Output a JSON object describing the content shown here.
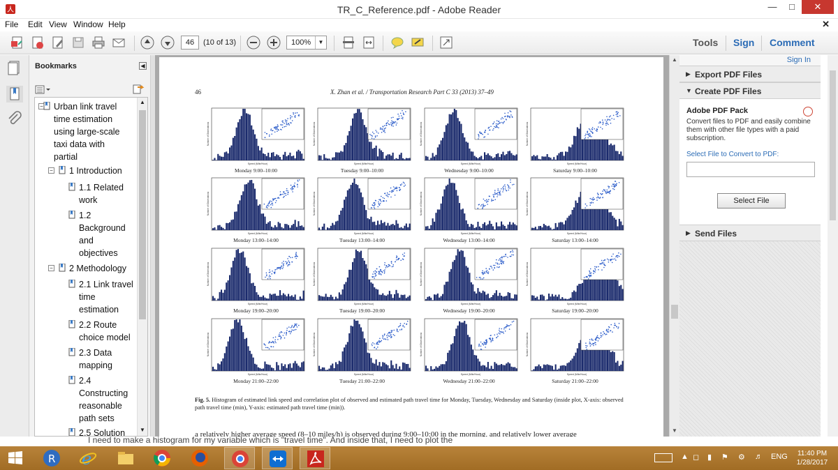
{
  "window": {
    "title": "TR_C_Reference.pdf - Adobe Reader"
  },
  "menu": [
    "File",
    "Edit",
    "View",
    "Window",
    "Help"
  ],
  "toolbar": {
    "page_current": "46",
    "page_count": "(10 of 13)",
    "zoom": "100%",
    "right_tabs": [
      "Tools",
      "Sign",
      "Comment"
    ]
  },
  "bookmarks": {
    "header": "Bookmarks",
    "items": [
      {
        "label": "Urban link travel time estimation using large-scale taxi data with partial",
        "lines": [
          "Urban link travel",
          "time estimation",
          "using large-scale",
          "taxi data with",
          "partial"
        ],
        "toggle": "−"
      },
      {
        "lines": [
          "1 Introduction"
        ],
        "toggle": "−"
      },
      {
        "lines": [
          "1.1 Related",
          "work"
        ]
      },
      {
        "lines": [
          "1.2",
          "Background",
          "and",
          "objectives"
        ]
      },
      {
        "lines": [
          "2 Methodology"
        ],
        "toggle": "−"
      },
      {
        "lines": [
          "2.1 Link travel",
          "time",
          "estimation"
        ]
      },
      {
        "lines": [
          "2.2 Route",
          "choice model"
        ]
      },
      {
        "lines": [
          "2.3 Data",
          "mapping"
        ]
      },
      {
        "lines": [
          "2.4",
          "Constructing",
          "reasonable",
          "path sets"
        ]
      },
      {
        "lines": [
          "2.5 Solution"
        ]
      }
    ]
  },
  "document": {
    "page_number": "46",
    "running_head": "X. Zhan et al. / Transportation Research Part C 33 (2013) 37–49",
    "panels": [
      "Monday 9:00–10:00",
      "Tuesday 9:00–10:00",
      "Wednesday 9:00–10:00",
      "Saturday 9:00–10:00",
      "Monday 13:00–14:00",
      "Tuesday 13:00–14:00",
      "Wednesday 13:00–14:00",
      "Saturday 13:00–14:00",
      "Monday 19:00–20:00",
      "Tuesday 19:00–20:00",
      "Wednesday 19:00–20:00",
      "Saturday 19:00–20:00",
      "Monday 21:00–22:00",
      "Tuesday 21:00–22:00",
      "Wednesday 21:00–22:00",
      "Saturday 21:00–22:00"
    ],
    "axis_x_label": "Speed (Mile/Hour)",
    "axis_y_label": "Number of Observations",
    "caption_label": "Fig. 5.",
    "caption_text": "Histogram of estimated link speed and correlation plot of observed and estimated path travel time for Monday, Tuesday, Wednesday and Saturday (inside plot, X-axis: observed path travel time (min), Y-axis: estimated path travel time (min)).",
    "body_line": "a relatively higher average speed (8–10 miles/h) is observed during 9:00–10:00 in the morning, and relatively lower average"
  },
  "right_pane": {
    "sign_in": "Sign In",
    "sections": [
      "Export PDF Files",
      "Create PDF Files",
      "Send Files"
    ],
    "pack_title": "Adobe PDF Pack",
    "pack_desc": "Convert files to PDF and easily combine them with other file types with a paid subscription.",
    "convert_label": "Select File to Convert to PDF:",
    "select_button": "Select File"
  },
  "background_text": "I need to make a histogram for my variable which is \"travel time\". And inside that, I need to plot the",
  "taskbar": {
    "apps": [
      "start-icon",
      "r-icon",
      "ie-icon",
      "file-explorer-icon",
      "chrome-icon",
      "firefox-icon",
      "chrome-canary-icon",
      "teamviewer-icon",
      "acrobat-icon"
    ],
    "language": "ENG",
    "time": "11:40 PM",
    "date": "1/28/2017"
  }
}
